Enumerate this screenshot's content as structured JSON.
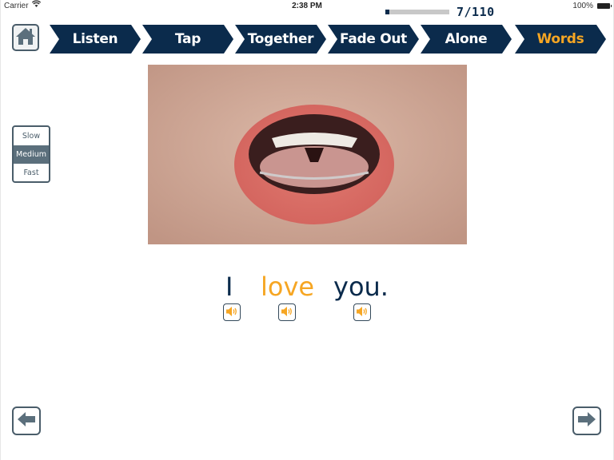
{
  "status_bar": {
    "carrier": "Carrier",
    "time": "2:38 PM",
    "battery": "100%"
  },
  "progress": {
    "current": 7,
    "total": 110,
    "label": "7/110",
    "fraction": 0.064
  },
  "steps": [
    {
      "label": "Listen",
      "active": false
    },
    {
      "label": "Tap",
      "active": false
    },
    {
      "label": "Together",
      "active": false
    },
    {
      "label": "Fade Out",
      "active": false
    },
    {
      "label": "Alone",
      "active": false
    },
    {
      "label": "Words",
      "active": true
    }
  ],
  "speed": {
    "options": [
      "Slow",
      "Medium",
      "Fast"
    ],
    "selected": "Medium"
  },
  "sentence": {
    "words": [
      {
        "text": "I",
        "highlighted": false
      },
      {
        "text": "love",
        "highlighted": true
      },
      {
        "text": "you.",
        "highlighted": false
      }
    ]
  },
  "colors": {
    "navy": "#0b2b4c",
    "accent": "#f6a623",
    "slate": "#4a5d6a"
  },
  "icons": {
    "home": "home-icon",
    "speaker": "speaker-icon",
    "back": "arrow-left-icon",
    "next": "arrow-right-icon"
  }
}
